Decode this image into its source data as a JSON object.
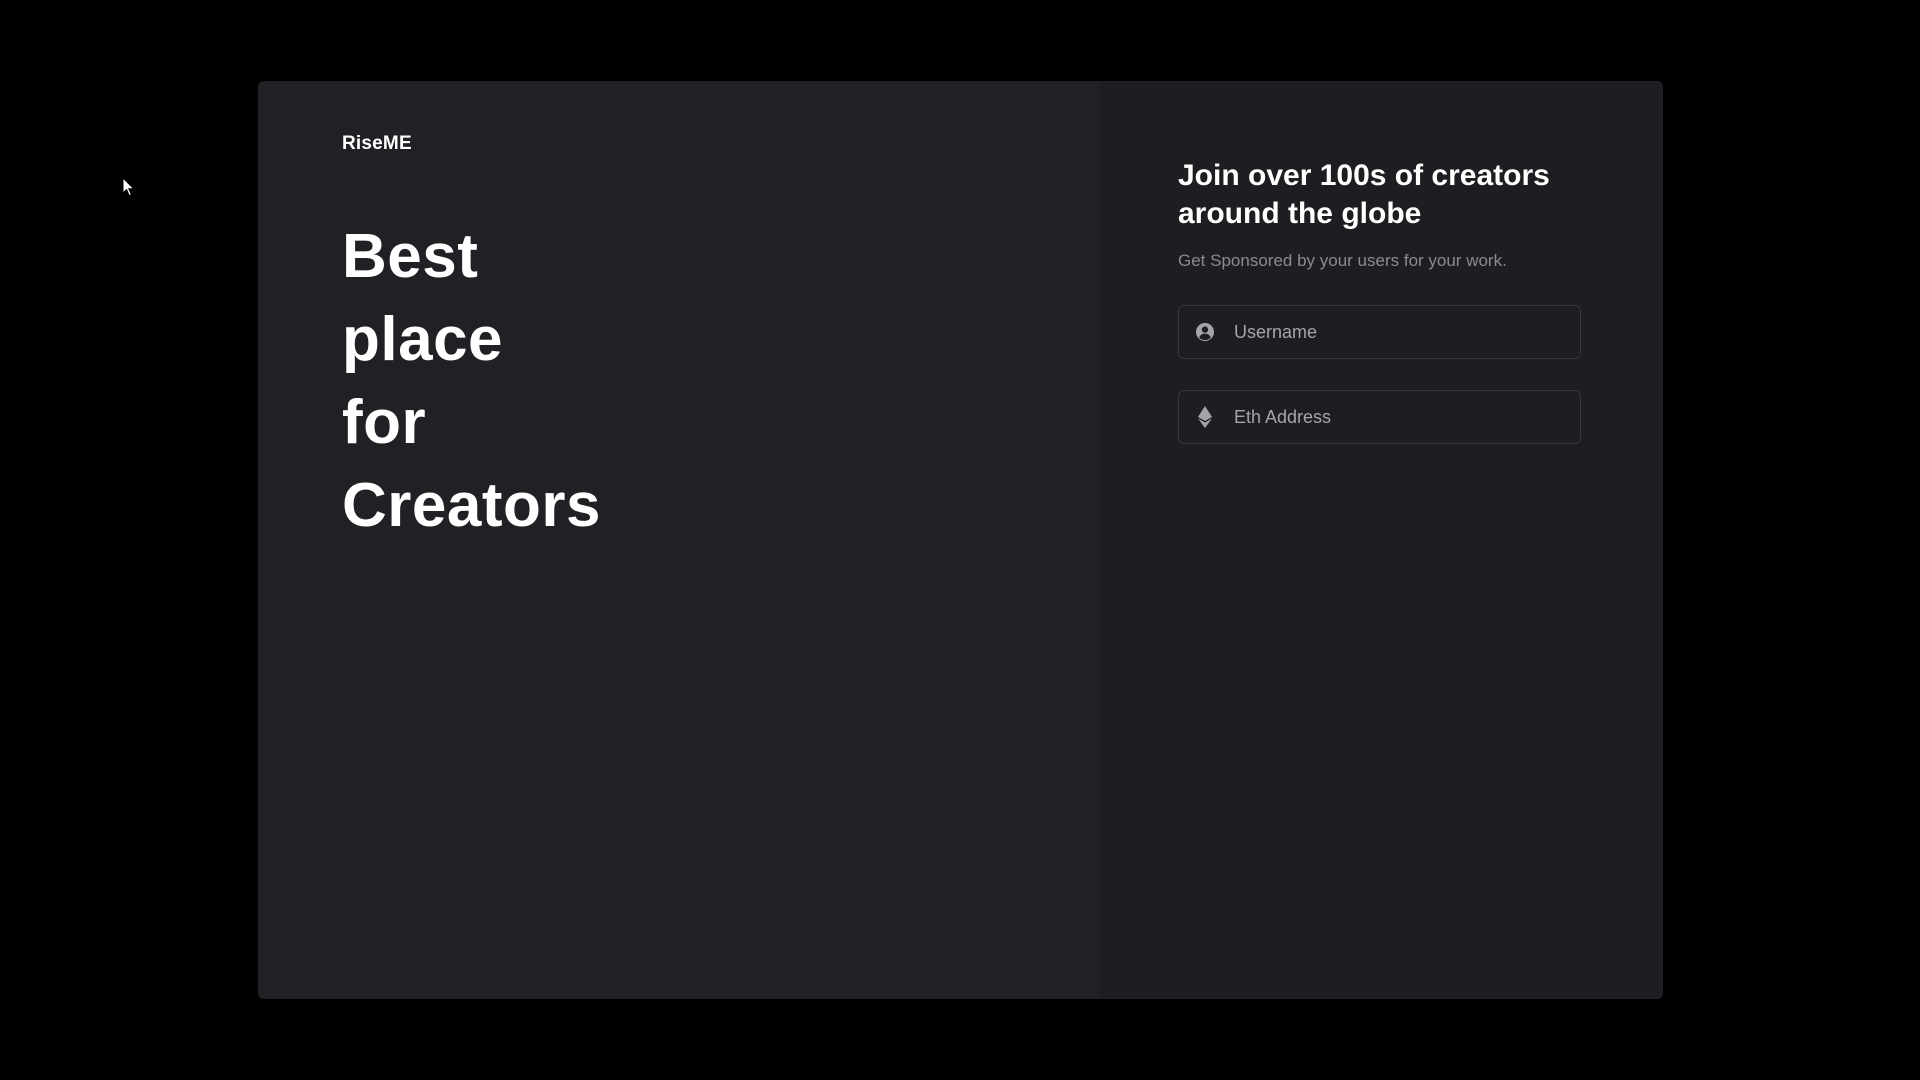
{
  "brand": {
    "name": "RiseME"
  },
  "hero": {
    "lines": [
      "Best",
      "place",
      "for",
      "Creators"
    ]
  },
  "signup": {
    "title": "Join over 100s of creators around the globe",
    "subtitle": "Get Sponsored by your users for your work.",
    "username": {
      "value": "",
      "placeholder": "Username",
      "icon": "user-circle-icon"
    },
    "eth_address": {
      "value": "",
      "placeholder": "Eth Address",
      "icon": "ethereum-icon"
    }
  },
  "colors": {
    "page_background": "#000000",
    "left_panel": "#202125",
    "right_panel": "#1d1e21",
    "text_primary": "#ffffff",
    "text_muted": "#8a8b90",
    "input_border": "#36373c"
  }
}
